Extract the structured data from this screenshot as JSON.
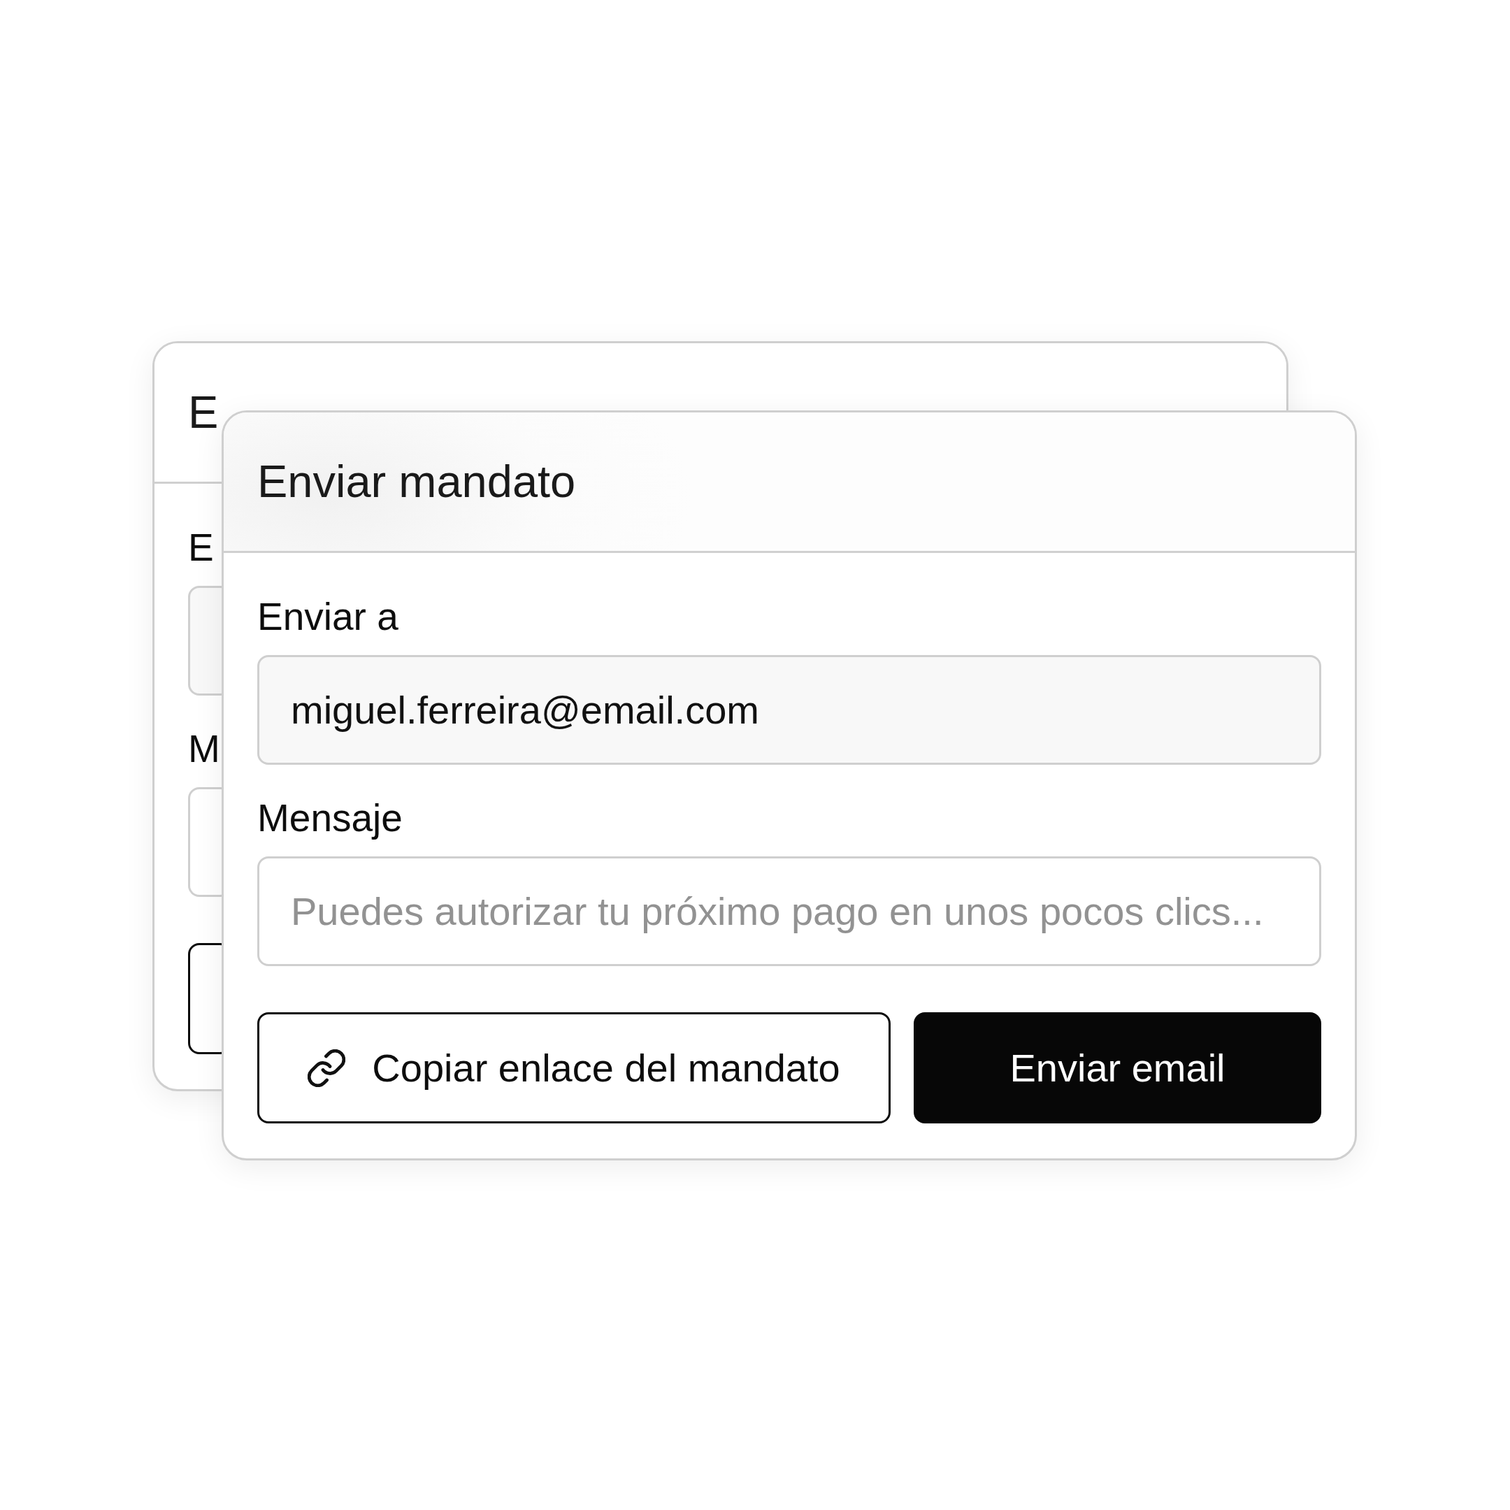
{
  "back_card": {
    "title": "E",
    "fields": [
      {
        "label": "E",
        "kind": "filled"
      },
      {
        "label": "M",
        "kind": "empty"
      }
    ],
    "buttons": [
      {
        "kind": "outline"
      }
    ]
  },
  "dialog": {
    "title": "Enviar mandato",
    "fields": [
      {
        "label": "Enviar a",
        "kind": "filled",
        "value": "miguel.ferreira@email.com"
      },
      {
        "label": "Mensaje",
        "kind": "empty",
        "placeholder": "Puedes autorizar tu próximo pago en unos pocos clics..."
      }
    ],
    "buttons": [
      {
        "kind": "link",
        "label": "Copiar enlace del mandato"
      },
      {
        "kind": "primary",
        "label": "Enviar email"
      }
    ]
  }
}
